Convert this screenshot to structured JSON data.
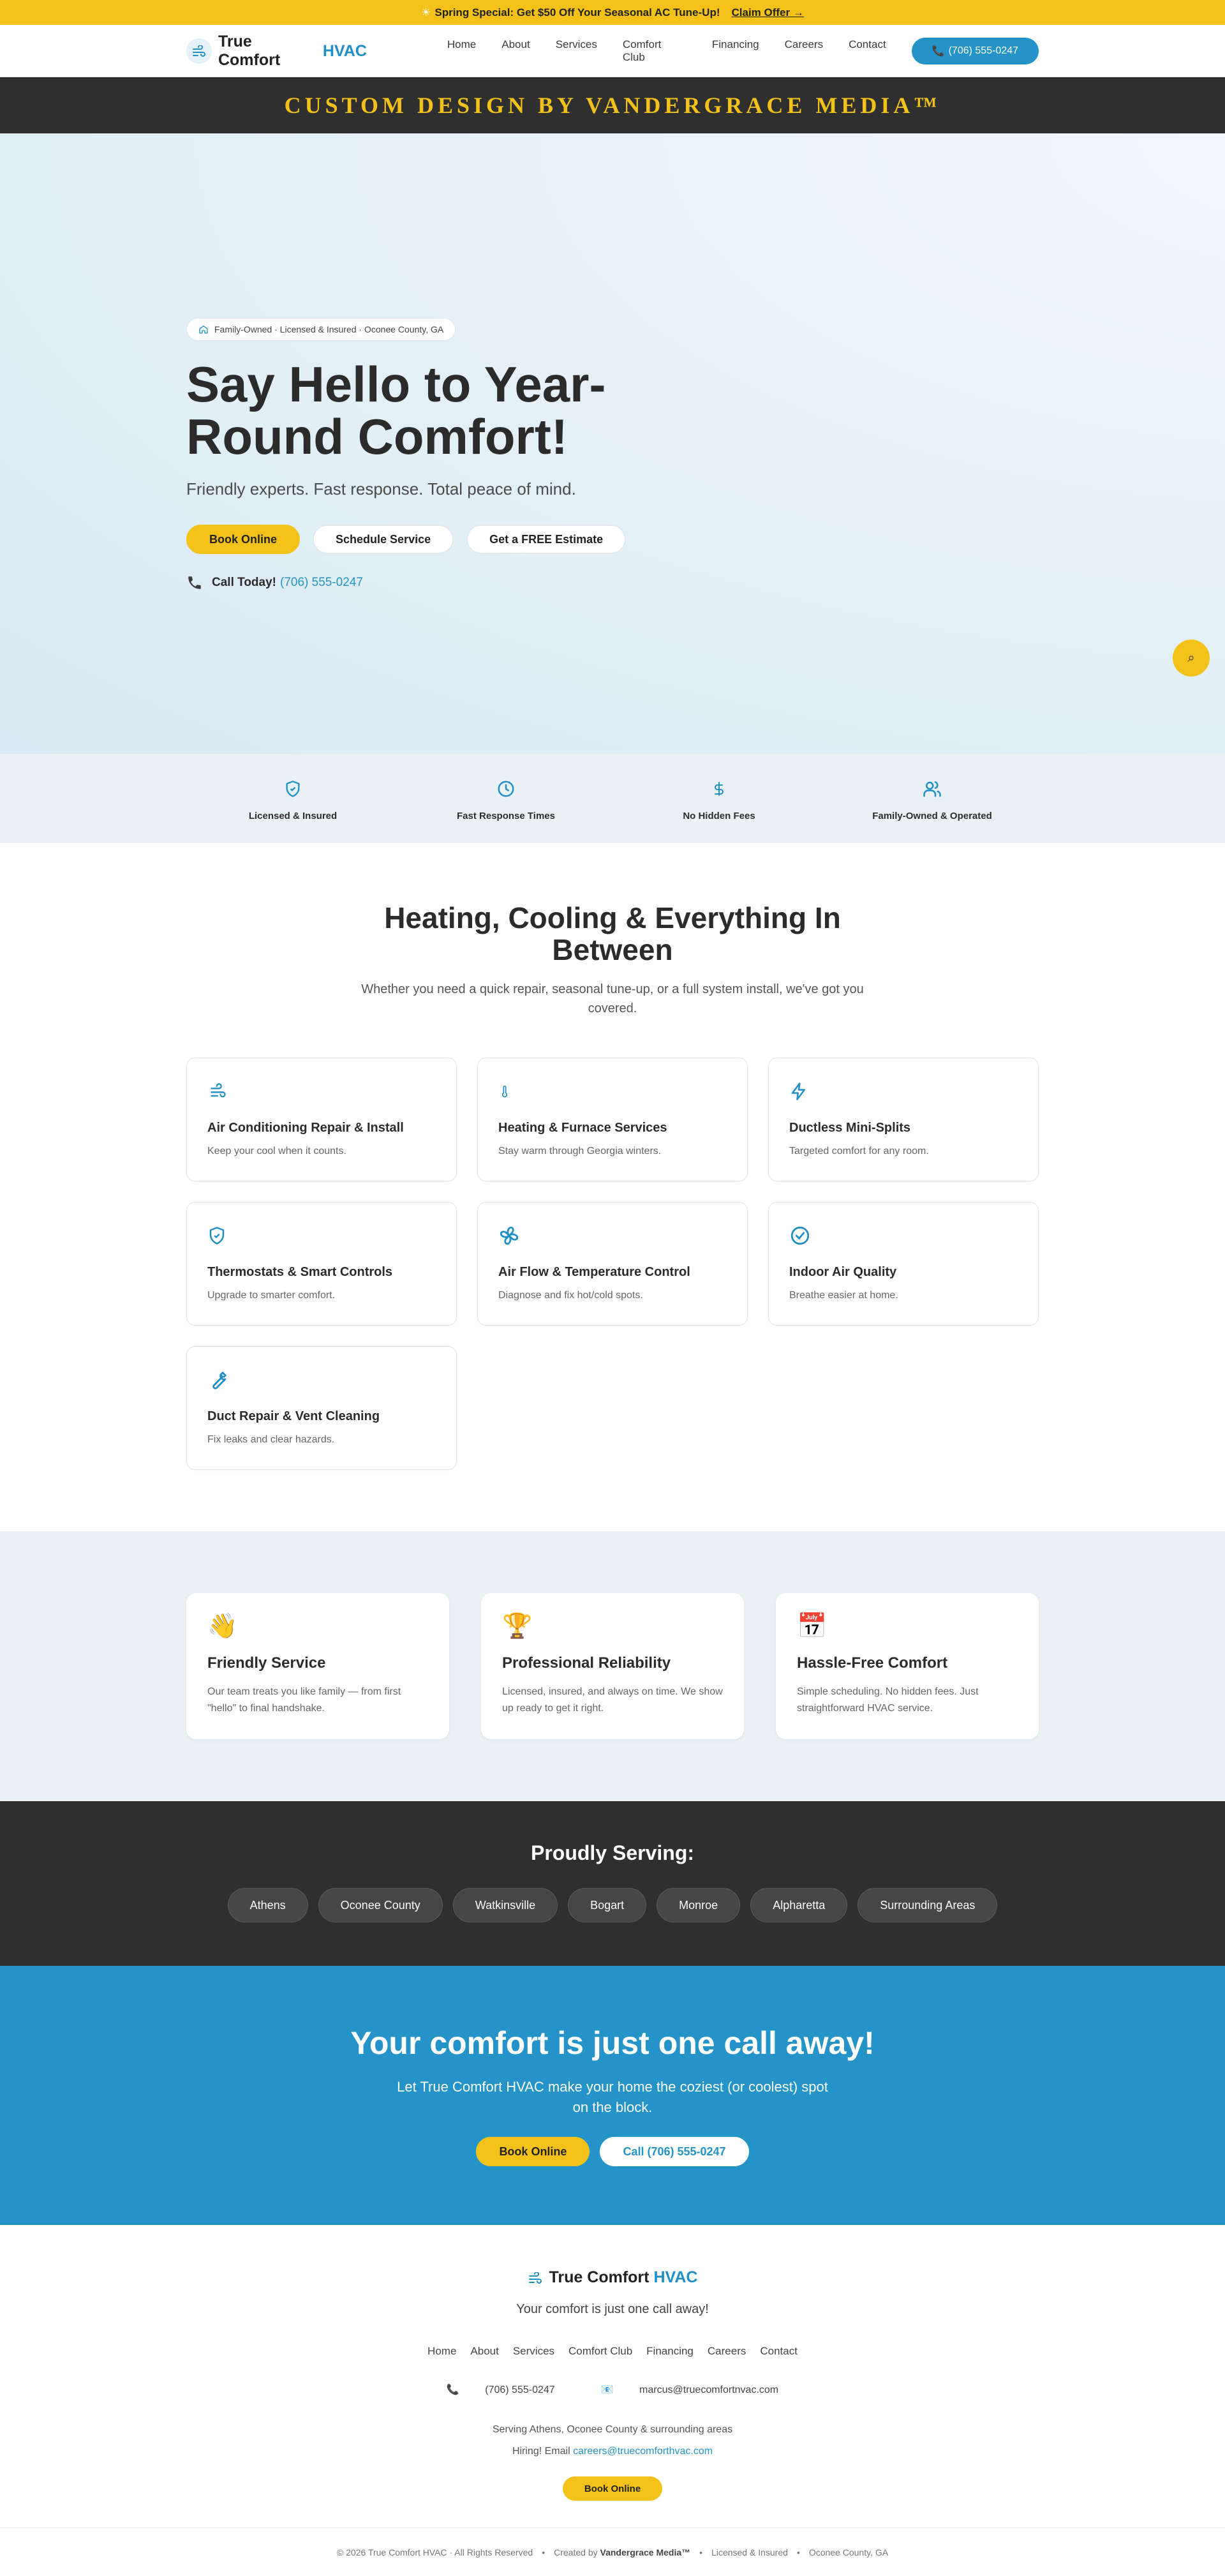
{
  "promo": {
    "text": "Spring Special: Get $50 Off Your Seasonal AC Tune-Up!",
    "link": "Claim Offer →"
  },
  "header": {
    "logo_main": "True Comfort",
    "logo_accent": "HVAC",
    "nav": [
      "Home",
      "About",
      "Services",
      "Comfort Club",
      "Financing",
      "Careers",
      "Contact"
    ],
    "phone": "(706) 555-0247"
  },
  "banner": {
    "text": "CUSTOM DESIGN BY VANDERGRACE MEDIA™"
  },
  "hero": {
    "badge": "Family-Owned · Licensed & Insured · Oconee County, GA",
    "title": "Say Hello to Year-Round Comfort!",
    "subtitle": "Friendly experts. Fast response. Total peace of mind.",
    "buttons": [
      "Book Online",
      "Schedule Service",
      "Get a FREE Estimate"
    ],
    "call_label": "Call Today!",
    "call_number": "(706) 555-0247"
  },
  "features": [
    {
      "label": "Licensed & Insured",
      "icon": "shield-icon"
    },
    {
      "label": "Fast Response Times",
      "icon": "clock-icon"
    },
    {
      "label": "No Hidden Fees",
      "icon": "dollar-icon"
    },
    {
      "label": "Family-Owned & Operated",
      "icon": "users-icon"
    }
  ],
  "services": {
    "title": "Heating, Cooling & Everything In Between",
    "lead": "Whether you need a quick repair, seasonal tune-up, or a full system install, we've got you covered.",
    "items": [
      {
        "title": "Air Conditioning Repair & Install",
        "desc": "Keep your cool when it counts.",
        "icon": "wind-icon"
      },
      {
        "title": "Heating & Furnace Services",
        "desc": "Stay warm through Georgia winters.",
        "icon": "thermometer-icon"
      },
      {
        "title": "Ductless Mini-Splits",
        "desc": "Targeted comfort for any room.",
        "icon": "bolt-icon"
      },
      {
        "title": "Thermostats & Smart Controls",
        "desc": "Upgrade to smarter comfort.",
        "icon": "shield-check-icon"
      },
      {
        "title": "Air Flow & Temperature Control",
        "desc": "Diagnose and fix hot/cold spots.",
        "icon": "fan-icon"
      },
      {
        "title": "Indoor Air Quality",
        "desc": "Breathe easier at home.",
        "icon": "check-circle-icon"
      },
      {
        "title": "Duct Repair & Vent Cleaning",
        "desc": "Fix leaks and clear hazards.",
        "icon": "wrench-icon"
      }
    ]
  },
  "values": [
    {
      "emoji": "👋",
      "title": "Friendly Service",
      "desc": "Our team treats you like family — from first \"hello\" to final handshake."
    },
    {
      "emoji": "🏆",
      "title": "Professional Reliability",
      "desc": "Licensed, insured, and always on time. We show up ready to get it right."
    },
    {
      "emoji": "📅",
      "title": "Hassle-Free Comfort",
      "desc": "Simple scheduling. No hidden fees. Just straightforward HVAC service."
    }
  ],
  "serving": {
    "title": "Proudly Serving:",
    "areas": [
      "Athens",
      "Oconee County",
      "Watkinsville",
      "Bogart",
      "Monroe",
      "Alpharetta",
      "Surrounding Areas"
    ]
  },
  "cta": {
    "title": "Your comfort is just one call away!",
    "text": "Let True Comfort HVAC make your home the coziest (or coolest) spot on the block.",
    "book": "Book Online",
    "call": "Call (706) 555-0247"
  },
  "footer": {
    "logo_main": "True Comfort",
    "logo_accent": "HVAC",
    "tagline": "Your comfort is just one call away!",
    "nav": [
      "Home",
      "About",
      "Services",
      "Comfort Club",
      "Financing",
      "Careers",
      "Contact"
    ],
    "phone": "(706) 555-0247",
    "email": "marcus@truecomfortnvac.com",
    "serving": "Serving Athens, Oconee County & surrounding areas",
    "hiring_label": "Hiring! Email",
    "hiring_email": "careers@truecomforthvac.com",
    "book": "Book Online",
    "copyright": "© 2026 True Comfort HVAC · All Rights Reserved",
    "created_label": "Created by",
    "created_by": "Vandergrace Media™",
    "licensed": "Licensed & Insured",
    "location": "Oconee County, GA"
  },
  "colors": {
    "brand_blue": "#2493c7",
    "brand_yellow": "#f2c21b",
    "dark": "#2f2f2f",
    "light_bg": "#eaf1f5"
  }
}
